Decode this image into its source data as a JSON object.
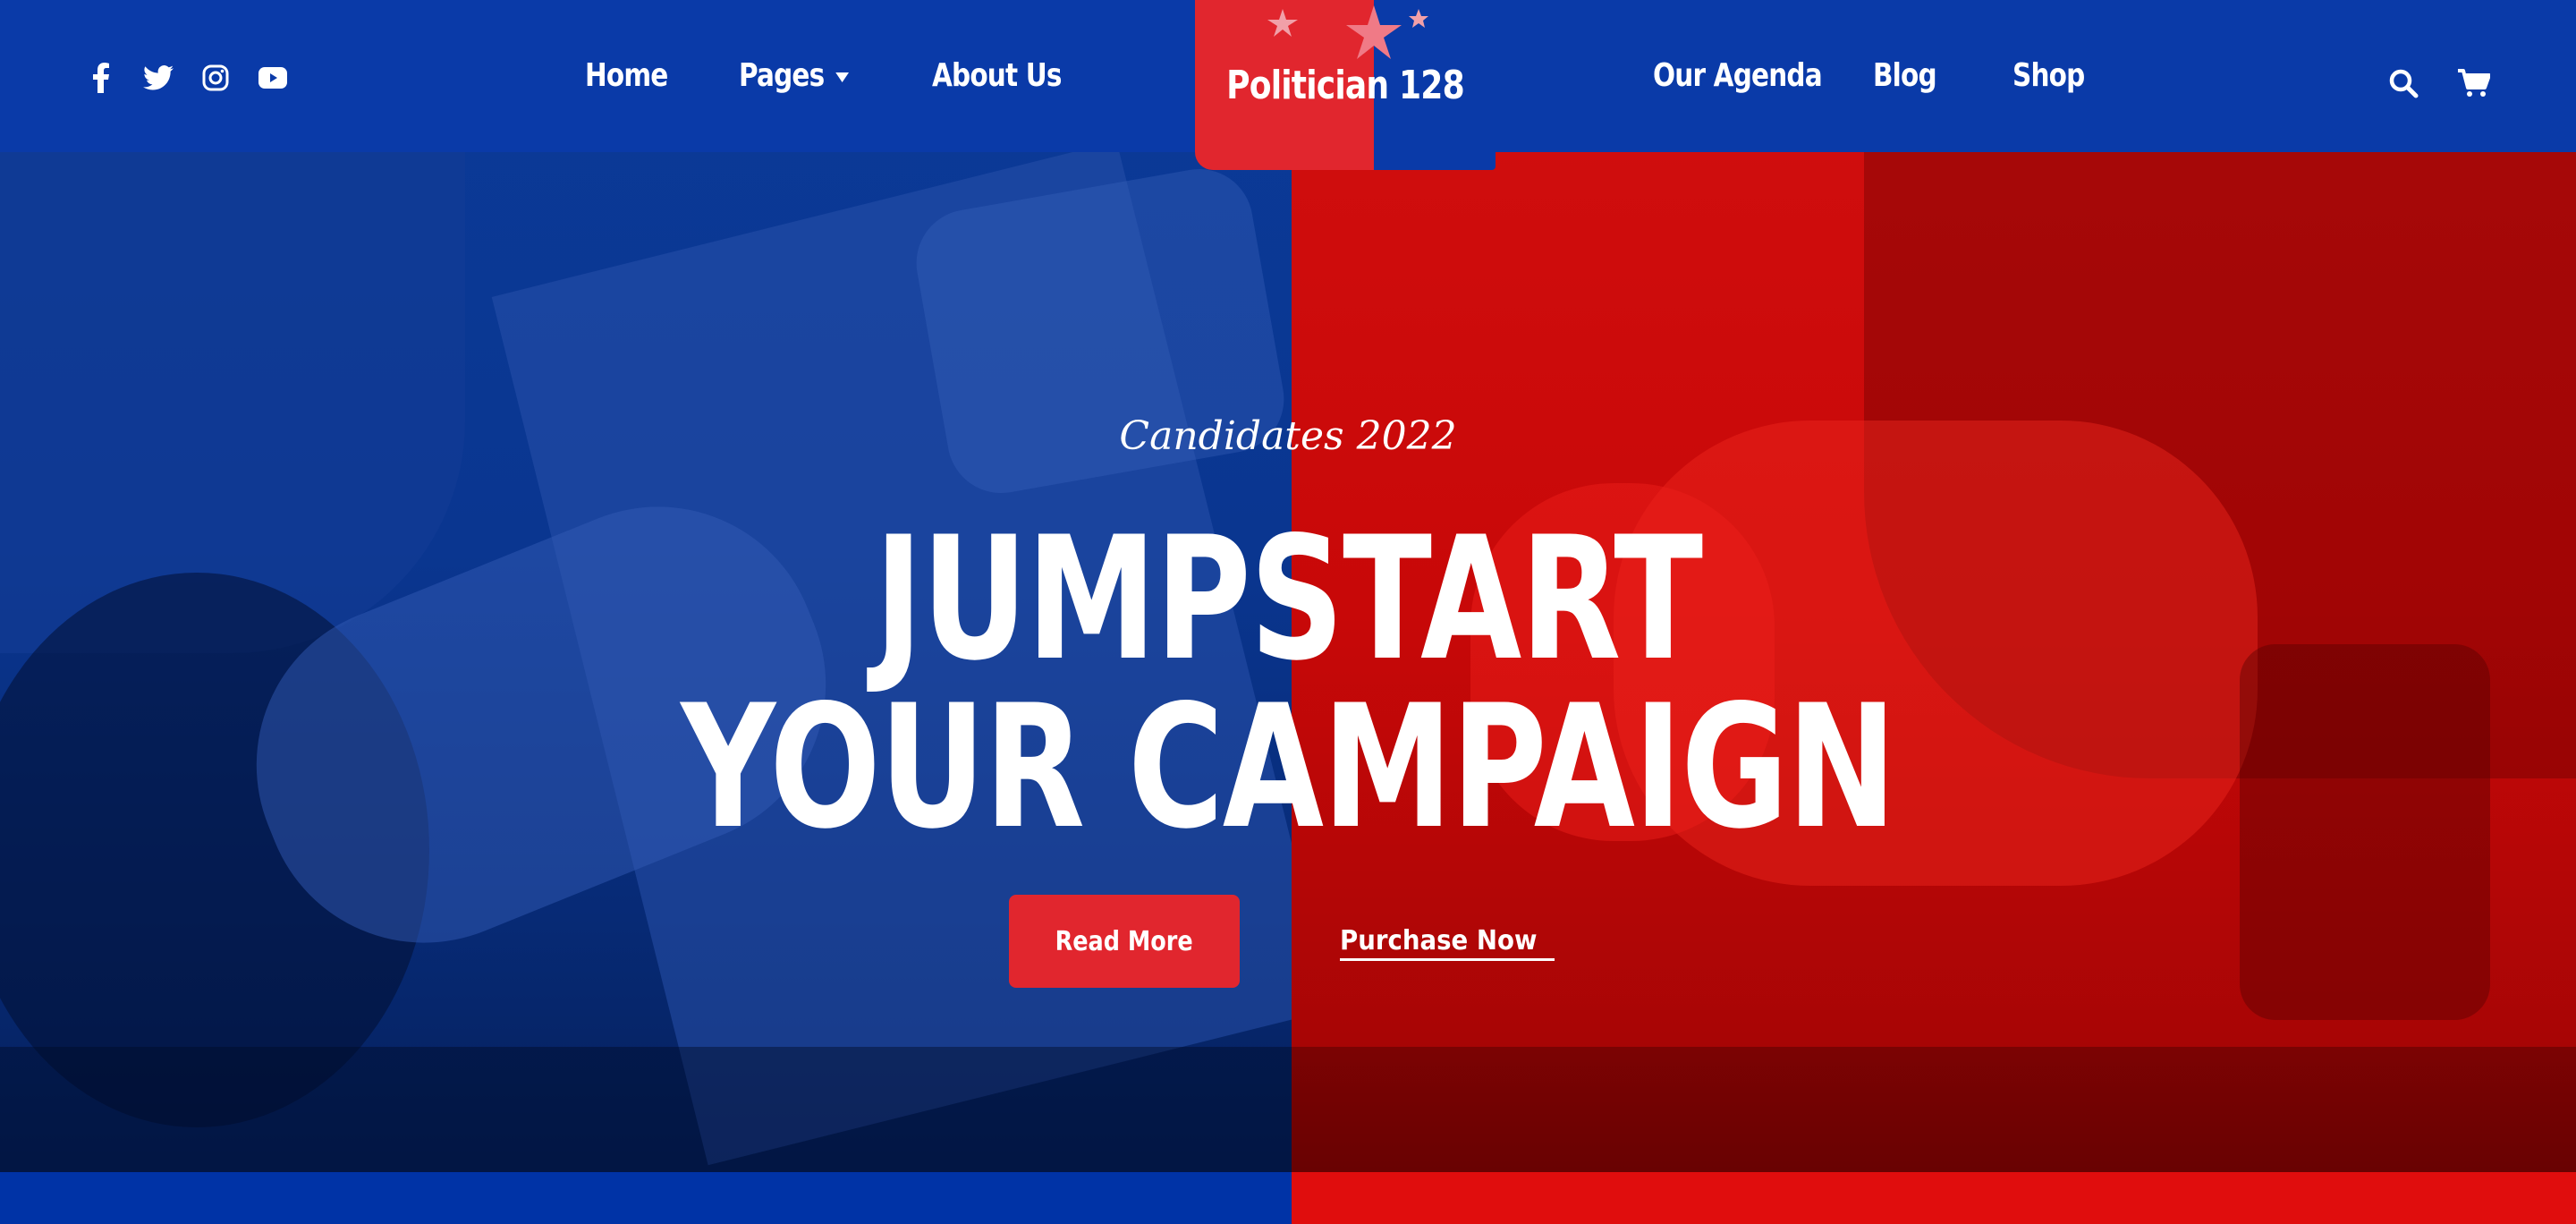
{
  "colors": {
    "brand_blue": "#0a3aa8",
    "brand_red": "#e1262e",
    "text": "#ffffff"
  },
  "header": {
    "social_icons": [
      "facebook-icon",
      "twitter-icon",
      "instagram-icon",
      "youtube-icon"
    ],
    "nav_left": [
      {
        "label": "Home"
      },
      {
        "label": "Pages",
        "has_dropdown": true
      },
      {
        "label": "About Us"
      }
    ],
    "logo_text": "Politician 128",
    "nav_right": [
      {
        "label": "Our Agenda"
      },
      {
        "label": "Blog"
      },
      {
        "label": "Shop"
      }
    ],
    "utility_icons": [
      "search-icon",
      "cart-icon"
    ]
  },
  "hero": {
    "subtitle": "Candidates 2022",
    "headline_line1": "JUMPSTART",
    "headline_line2": "YOUR CAMPAIGN",
    "primary_button": "Read More",
    "secondary_link": "Purchase Now"
  }
}
